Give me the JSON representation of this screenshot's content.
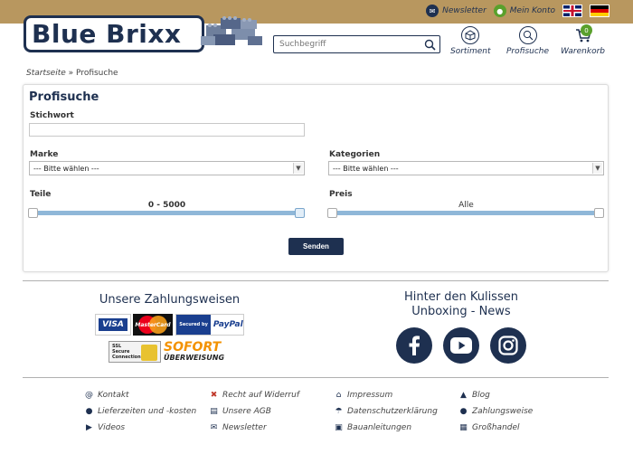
{
  "topbar": {
    "newsletter": "Newsletter",
    "account": "Mein Konto"
  },
  "logo": {
    "text": "Blue Brixx"
  },
  "search": {
    "placeholder": "Suchbegriff"
  },
  "nav": {
    "assortment": "Sortiment",
    "advanced_search": "Profisuche",
    "cart": "Warenkorb",
    "cart_count": "0"
  },
  "breadcrumb": {
    "home": "Startseite",
    "separator": "»",
    "current": "Profisuche"
  },
  "form": {
    "title": "Profisuche",
    "keyword_label": "Stichwort",
    "brand_label": "Marke",
    "brand_selected": "--- Bitte wählen ---",
    "category_label": "Kategorien",
    "category_selected": "--- Bitte wählen ---",
    "parts_label": "Teile",
    "parts_range": "0 - 5000",
    "price_label": "Preis",
    "price_range": "Alle",
    "submit": "Senden"
  },
  "payments": {
    "title": "Unsere Zahlungsweisen",
    "visa": "VISA",
    "mastercard": "MasterCard",
    "paypal_secured": "Secured by",
    "paypal": "PayPal",
    "ssl_line1": "SSL",
    "ssl_line2": "Secure",
    "ssl_line3": "Connection",
    "sofort": "SOFORT",
    "sofort_sub": "ÜBERWEISUNG"
  },
  "behind": {
    "title_line1": "Hinter den Kulissen",
    "title_line2": "Unboxing - News"
  },
  "footer_links": {
    "col1": [
      "Kontakt",
      "Lieferzeiten und -kosten",
      "Videos"
    ],
    "col2": [
      "Recht auf Widerruf",
      "Unsere AGB",
      "Newsletter"
    ],
    "col3": [
      "Impressum",
      "Datenschutzerklärung",
      "Bauanleitungen"
    ],
    "col4": [
      "Blog",
      "Zahlungsweise",
      "Großhandel"
    ]
  },
  "colors": {
    "brand": "#1e3050",
    "topbar": "#b8975f",
    "accent": "#5aa02c",
    "slider": "#8fb7d8"
  }
}
